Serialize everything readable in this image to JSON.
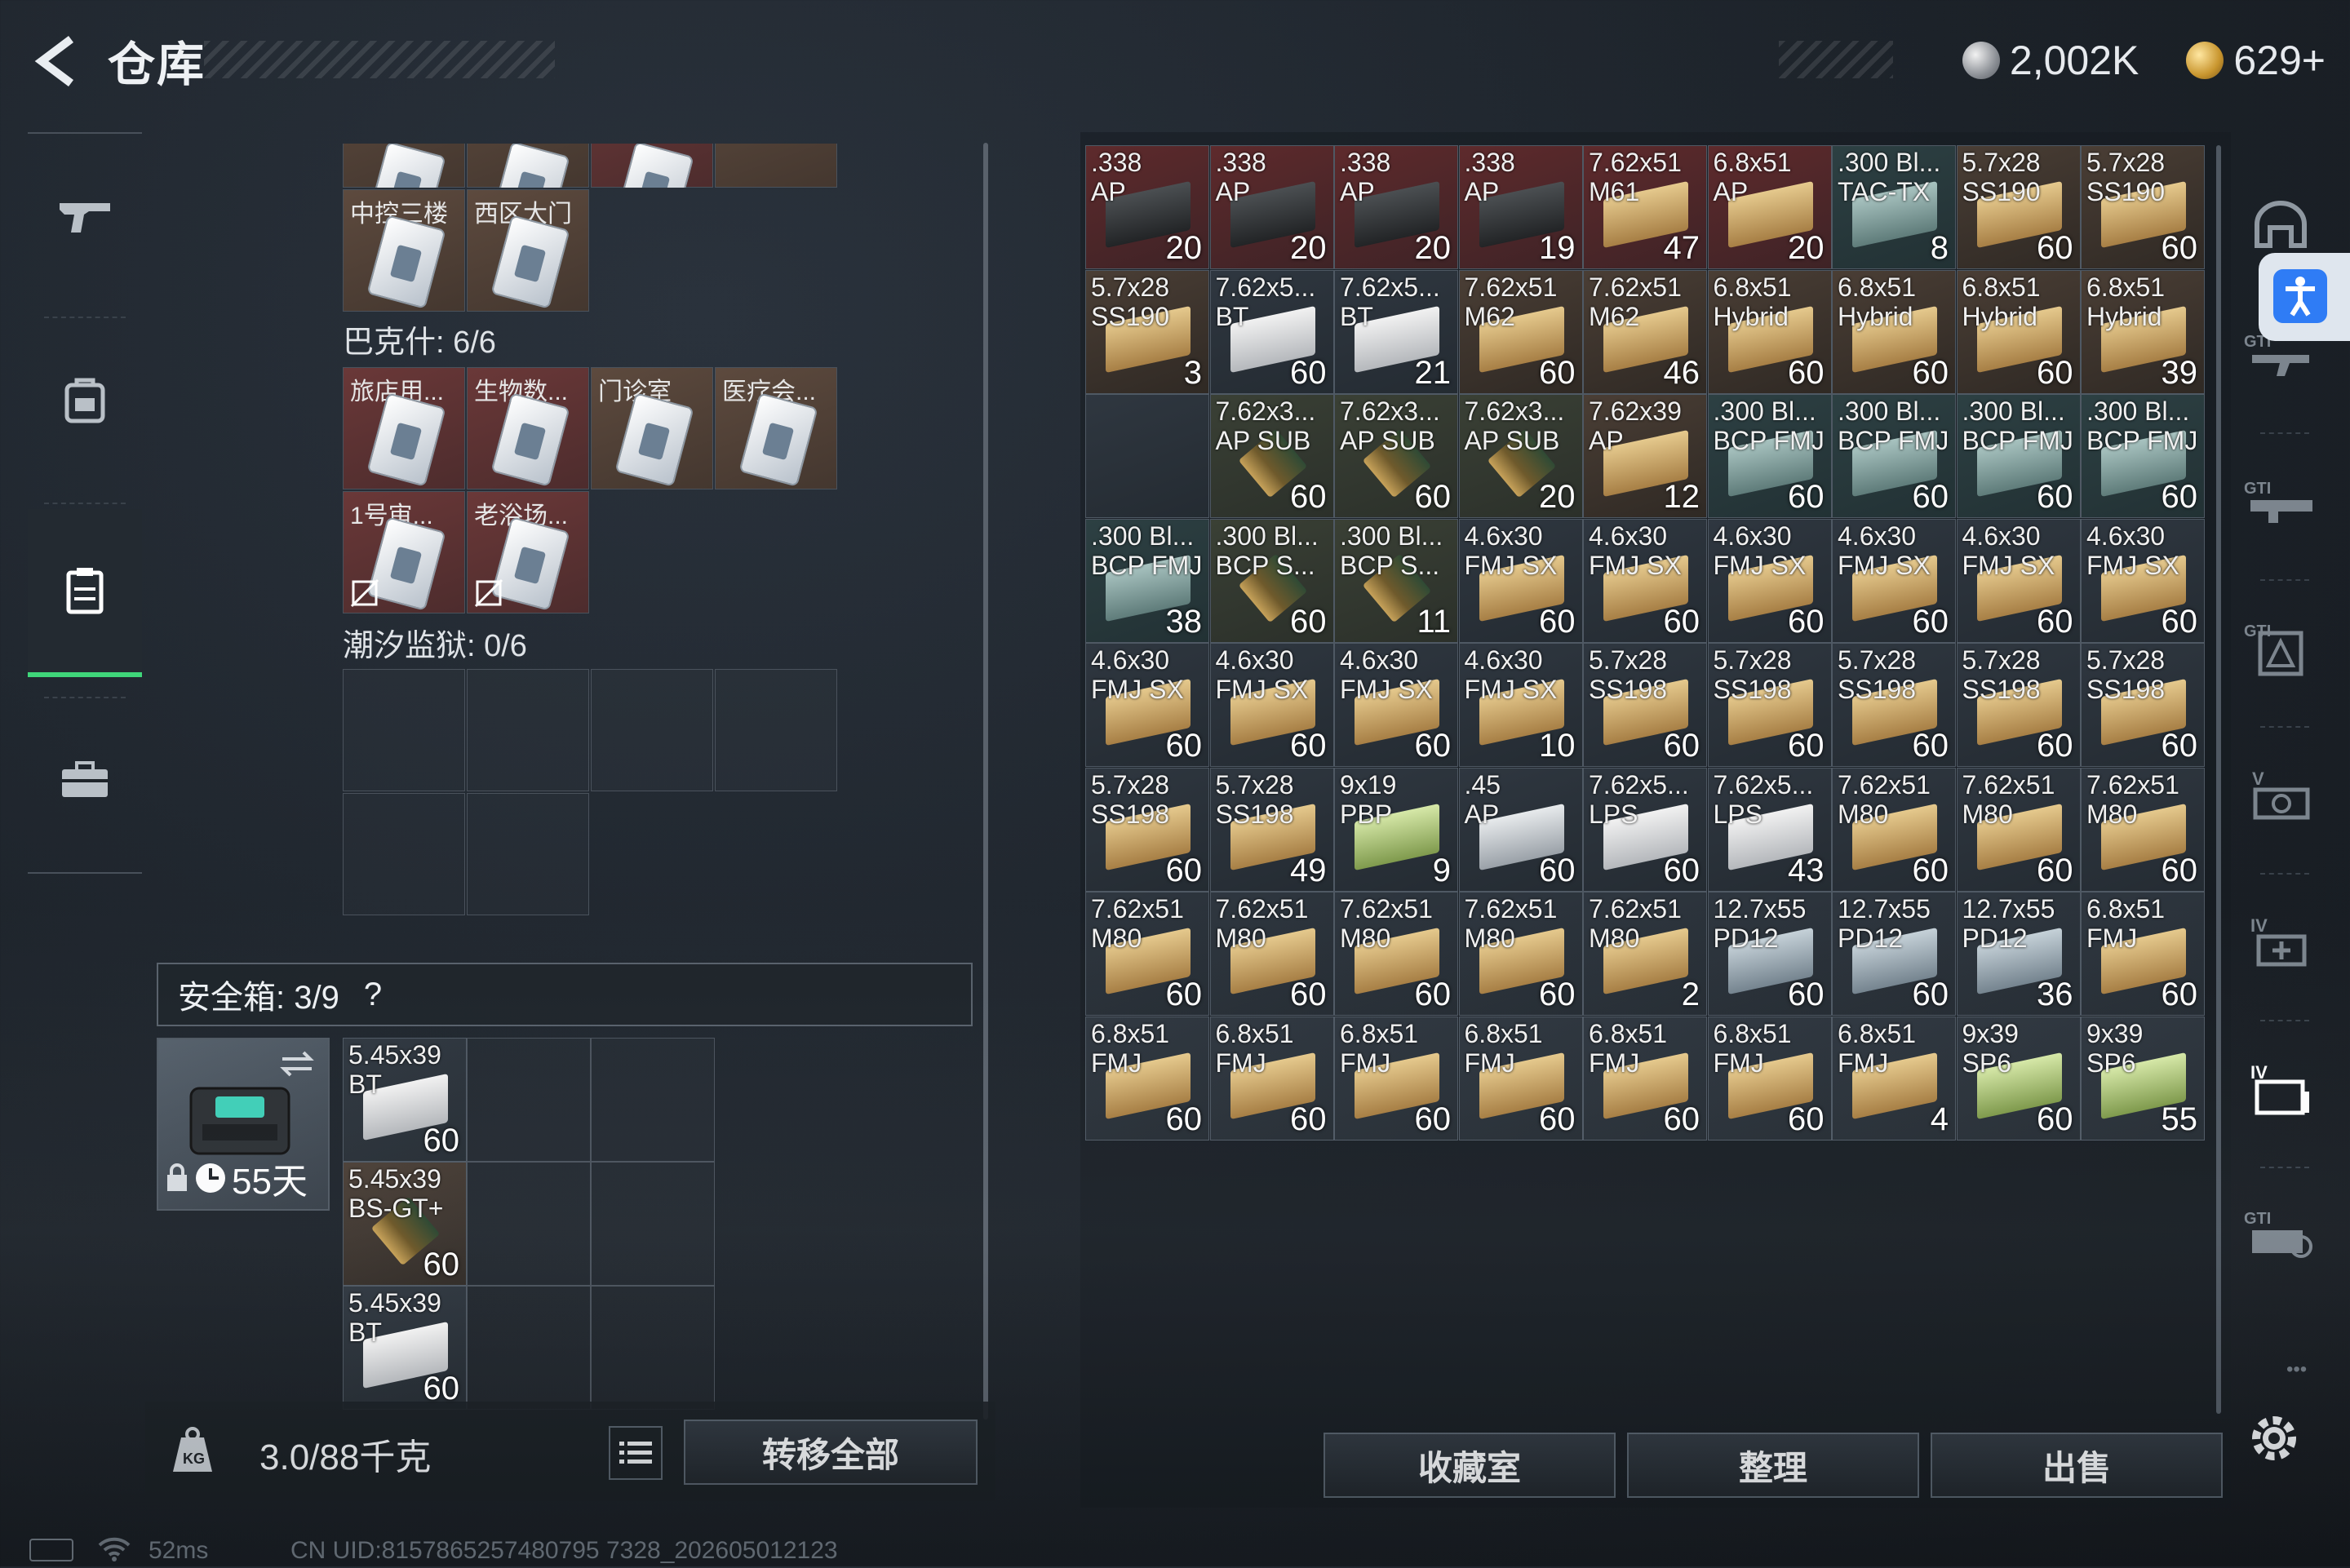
{
  "header": {
    "title": "仓库",
    "silver": "2,002K",
    "gold": "629+"
  },
  "left_nav": {
    "icons": [
      "gun-icon",
      "backpack-icon",
      "storage-case-icon",
      "briefcase-icon"
    ]
  },
  "keys_top": [
    {
      "label": "中控三楼",
      "bg": "brown"
    },
    {
      "label": "西区大门",
      "bg": "brown"
    }
  ],
  "bakesh": {
    "title": "巴克什: 6/6"
  },
  "keys_mid": [
    {
      "label": "旅店用...",
      "bg": "red",
      "locked": false
    },
    {
      "label": "生物数...",
      "bg": "red",
      "locked": false
    },
    {
      "label": "门诊室",
      "bg": "brown",
      "locked": false
    },
    {
      "label": "医疗会...",
      "bg": "brown",
      "locked": false
    },
    {
      "label": "1号审...",
      "bg": "red",
      "locked": true
    },
    {
      "label": "老浴场...",
      "bg": "red",
      "locked": true
    }
  ],
  "tide": {
    "title": "潮汐监狱: 0/6"
  },
  "safe": {
    "title": "安全箱:  3/9",
    "help": "?",
    "days": "55天"
  },
  "safe_items": [
    {
      "name": "5.45x39\nBT",
      "count": "60",
      "box": "white",
      "bg": "dark"
    },
    {
      "name": "5.45x39\nBS-GT+",
      "count": "60",
      "box": "bullet",
      "bg": "brown"
    },
    {
      "name": "5.45x39\nBT",
      "count": "60",
      "box": "white",
      "bg": "dark"
    }
  ],
  "weight": {
    "text": "3.0/88千克"
  },
  "buttons": {
    "transfer_all": "转移全部",
    "collection": "收藏室",
    "organize": "整理",
    "sell": "出售"
  },
  "status": {
    "ping": "52ms",
    "uid": "CN UID:8157865257480795 7328_202605012123"
  },
  "ammo_grid": [
    [
      {
        "name": ".338\nAP",
        "count": "20",
        "box": "black",
        "bg": "red"
      },
      {
        "name": ".338\nAP",
        "count": "20",
        "box": "black",
        "bg": "red"
      },
      {
        "name": ".338\nAP",
        "count": "20",
        "box": "black",
        "bg": "red"
      },
      {
        "name": ".338\nAP",
        "count": "19",
        "box": "black",
        "bg": "red"
      },
      {
        "name": "7.62x51\nM61",
        "count": "47",
        "box": "tan",
        "bg": "red"
      },
      {
        "name": "6.8x51\nAP",
        "count": "20",
        "box": "tan",
        "bg": "red"
      },
      {
        "name": ".300 Bl...\nTAC-TX",
        "count": "8",
        "box": "teal",
        "bg": "teal"
      },
      {
        "name": "5.7x28\nSS190",
        "count": "60",
        "box": "tan",
        "bg": "brown"
      },
      {
        "name": "5.7x28\nSS190",
        "count": "60",
        "box": "tan",
        "bg": "brown"
      }
    ],
    [
      {
        "name": "5.7x28\nSS190",
        "count": "3",
        "box": "tan",
        "bg": "brown"
      },
      {
        "name": "7.62x5...\nBT",
        "count": "60",
        "box": "white",
        "bg": "dark"
      },
      {
        "name": "7.62x5...\nBT",
        "count": "21",
        "box": "white",
        "bg": "dark"
      },
      {
        "name": "7.62x51\nM62",
        "count": "60",
        "box": "tan",
        "bg": "brown"
      },
      {
        "name": "7.62x51\nM62",
        "count": "46",
        "box": "tan",
        "bg": "brown"
      },
      {
        "name": "6.8x51\nHybrid",
        "count": "60",
        "box": "tan",
        "bg": "brown"
      },
      {
        "name": "6.8x51\nHybrid",
        "count": "60",
        "box": "tan",
        "bg": "brown"
      },
      {
        "name": "6.8x51\nHybrid",
        "count": "60",
        "box": "tan",
        "bg": "brown"
      },
      {
        "name": "6.8x51\nHybrid",
        "count": "39",
        "box": "tan",
        "bg": "brown"
      }
    ],
    [
      null,
      {
        "name": "7.62x3...\nAP SUB",
        "count": "60",
        "box": "bullet",
        "bg": "olive"
      },
      {
        "name": "7.62x3...\nAP SUB",
        "count": "60",
        "box": "bullet",
        "bg": "olive"
      },
      {
        "name": "7.62x3...\nAP SUB",
        "count": "20",
        "box": "bullet",
        "bg": "olive"
      },
      {
        "name": "7.62x39\nAP",
        "count": "12",
        "box": "tan",
        "bg": "brown"
      },
      {
        "name": ".300 Bl...\nBCP FMJ",
        "count": "60",
        "box": "teal",
        "bg": "teal"
      },
      {
        "name": ".300 Bl...\nBCP FMJ",
        "count": "60",
        "box": "teal",
        "bg": "teal"
      },
      {
        "name": ".300 Bl...\nBCP FMJ",
        "count": "60",
        "box": "teal",
        "bg": "teal"
      },
      {
        "name": ".300 Bl...\nBCP FMJ",
        "count": "60",
        "box": "teal",
        "bg": "teal"
      }
    ],
    [
      {
        "name": ".300 Bl...\nBCP FMJ",
        "count": "38",
        "box": "teal",
        "bg": "teal"
      },
      {
        "name": ".300 Bl...\nBCP S...",
        "count": "60",
        "box": "bullet",
        "bg": "olive"
      },
      {
        "name": ".300 Bl...\nBCP S...",
        "count": "11",
        "box": "bullet",
        "bg": "olive"
      },
      {
        "name": "4.6x30\nFMJ SX",
        "count": "60",
        "box": "tan",
        "bg": "dark"
      },
      {
        "name": "4.6x30\nFMJ SX",
        "count": "60",
        "box": "tan",
        "bg": "dark"
      },
      {
        "name": "4.6x30\nFMJ SX",
        "count": "60",
        "box": "tan",
        "bg": "dark"
      },
      {
        "name": "4.6x30\nFMJ SX",
        "count": "60",
        "box": "tan",
        "bg": "dark"
      },
      {
        "name": "4.6x30\nFMJ SX",
        "count": "60",
        "box": "tan",
        "bg": "dark"
      },
      {
        "name": "4.6x30\nFMJ SX",
        "count": "60",
        "box": "tan",
        "bg": "dark"
      }
    ],
    [
      {
        "name": "4.6x30\nFMJ SX",
        "count": "60",
        "box": "tan",
        "bg": "dark"
      },
      {
        "name": "4.6x30\nFMJ SX",
        "count": "60",
        "box": "tan",
        "bg": "dark"
      },
      {
        "name": "4.6x30\nFMJ SX",
        "count": "60",
        "box": "tan",
        "bg": "dark"
      },
      {
        "name": "4.6x30\nFMJ SX",
        "count": "10",
        "box": "tan",
        "bg": "dark"
      },
      {
        "name": "5.7x28\nSS198",
        "count": "60",
        "box": "tan",
        "bg": "dark"
      },
      {
        "name": "5.7x28\nSS198",
        "count": "60",
        "box": "tan",
        "bg": "dark"
      },
      {
        "name": "5.7x28\nSS198",
        "count": "60",
        "box": "tan",
        "bg": "dark"
      },
      {
        "name": "5.7x28\nSS198",
        "count": "60",
        "box": "tan",
        "bg": "dark"
      },
      {
        "name": "5.7x28\nSS198",
        "count": "60",
        "box": "tan",
        "bg": "dark"
      }
    ],
    [
      {
        "name": "5.7x28\nSS198",
        "count": "60",
        "box": "tan",
        "bg": "dark"
      },
      {
        "name": "5.7x28\nSS198",
        "count": "49",
        "box": "tan",
        "bg": "dark"
      },
      {
        "name": "9x19\nPBP",
        "count": "9",
        "box": "green",
        "bg": "dark"
      },
      {
        "name": ".45\nAP",
        "count": "60",
        "box": "light",
        "bg": "dark"
      },
      {
        "name": "7.62x5...\nLPS",
        "count": "60",
        "box": "white",
        "bg": "dark"
      },
      {
        "name": "7.62x5...\nLPS",
        "count": "43",
        "box": "white",
        "bg": "dark"
      },
      {
        "name": "7.62x51\nM80",
        "count": "60",
        "box": "tan",
        "bg": "dark"
      },
      {
        "name": "7.62x51\nM80",
        "count": "60",
        "box": "tan",
        "bg": "dark"
      },
      {
        "name": "7.62x51\nM80",
        "count": "60",
        "box": "tan",
        "bg": "dark"
      }
    ],
    [
      {
        "name": "7.62x51\nM80",
        "count": "60",
        "box": "tan",
        "bg": "dark"
      },
      {
        "name": "7.62x51\nM80",
        "count": "60",
        "box": "tan",
        "bg": "dark"
      },
      {
        "name": "7.62x51\nM80",
        "count": "60",
        "box": "tan",
        "bg": "dark"
      },
      {
        "name": "7.62x51\nM80",
        "count": "60",
        "box": "tan",
        "bg": "dark"
      },
      {
        "name": "7.62x51\nM80",
        "count": "2",
        "box": "tan",
        "bg": "dark"
      },
      {
        "name": "12.7x55\nPD12",
        "count": "60",
        "box": "bluegrey",
        "bg": "dark"
      },
      {
        "name": "12.7x55\nPD12",
        "count": "60",
        "box": "bluegrey",
        "bg": "dark"
      },
      {
        "name": "12.7x55\nPD12",
        "count": "36",
        "box": "bluegrey",
        "bg": "dark"
      },
      {
        "name": "6.8x51\nFMJ",
        "count": "60",
        "box": "tan",
        "bg": "dark"
      }
    ],
    [
      {
        "name": "6.8x51\nFMJ",
        "count": "60",
        "box": "tan",
        "bg": "dark"
      },
      {
        "name": "6.8x51\nFMJ",
        "count": "60",
        "box": "tan",
        "bg": "dark"
      },
      {
        "name": "6.8x51\nFMJ",
        "count": "60",
        "box": "tan",
        "bg": "dark"
      },
      {
        "name": "6.8x51\nFMJ",
        "count": "60",
        "box": "tan",
        "bg": "dark"
      },
      {
        "name": "6.8x51\nFMJ",
        "count": "60",
        "box": "tan",
        "bg": "dark"
      },
      {
        "name": "6.8x51\nFMJ",
        "count": "60",
        "box": "tan",
        "bg": "dark"
      },
      {
        "name": "6.8x51\nFMJ",
        "count": "4",
        "box": "tan",
        "bg": "dark"
      },
      {
        "name": "9x39\nSP6",
        "count": "60",
        "box": "green",
        "bg": "dark"
      },
      {
        "name": "9x39\nSP6",
        "count": "55",
        "box": "green",
        "bg": "dark"
      }
    ]
  ],
  "right_nav": {
    "icons": [
      "helmet-icon",
      "gti-rifle-icon",
      "gti-smg-icon",
      "gti-armor-icon",
      "v-camera-icon",
      "iv-medkit-icon",
      "iv-folder-icon",
      "gti-gear-icon"
    ]
  }
}
